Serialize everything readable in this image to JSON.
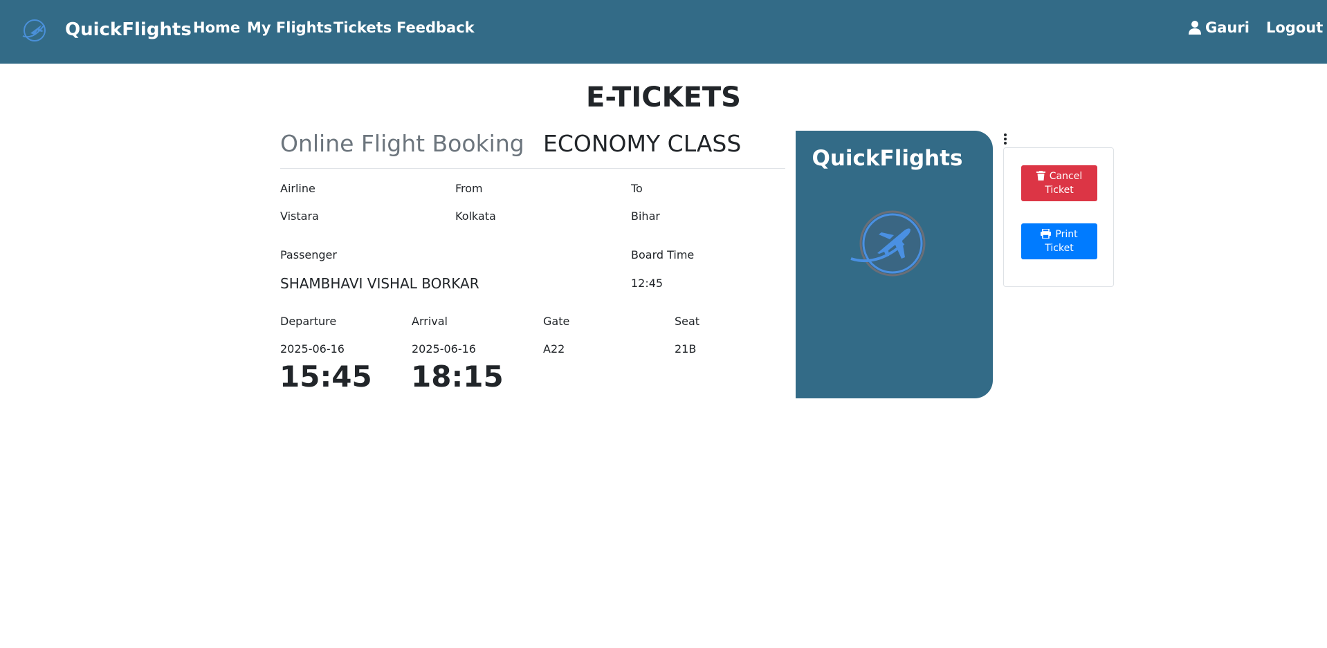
{
  "navbar": {
    "brand": "QuickFlights",
    "links": [
      "Home",
      "My Flights",
      "Tickets",
      "Feedback"
    ],
    "user": "Gauri",
    "logout": "Logout",
    "bg_color": "#336b87"
  },
  "page_title": "E-TICKETS",
  "ticket": {
    "heading": "Online Flight Booking",
    "class": "ECONOMY CLASS",
    "airline_label": "Airline",
    "airline": "Vistara",
    "from_label": "From",
    "from": "Kolkata",
    "to_label": "To",
    "to": "Bihar",
    "passenger_label": "Passenger",
    "passenger": "SHAMBHAVI VISHAL BORKAR",
    "board_time_label": "Board Time",
    "board_time": "12:45",
    "departure_label": "Departure",
    "departure_date": "2025-06-16",
    "departure_time": "15:45",
    "arrival_label": "Arrival",
    "arrival_date": "2025-06-16",
    "arrival_time": "18:15",
    "gate_label": "Gate",
    "gate": "A22",
    "seat_label": "Seat",
    "seat": "21B"
  },
  "stub": {
    "title": "QuickFlights"
  },
  "actions": {
    "cancel_line1": "Cancel",
    "cancel_line2": "Ticket",
    "print_line1": "Print",
    "print_line2": "Ticket",
    "cancel_color": "#dc3545",
    "print_color": "#007bff"
  }
}
